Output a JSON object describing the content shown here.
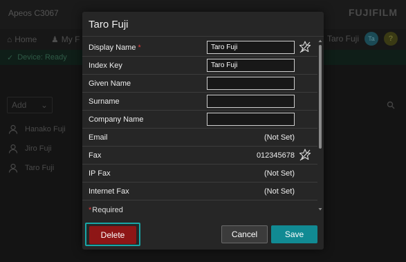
{
  "background": {
    "device_title": "Apeos C3067",
    "brand": "FUJIFILM",
    "nav": {
      "home": "Home",
      "my": "My F"
    },
    "user": {
      "name": "Taro Fuji",
      "initials": "Ta",
      "help": "?"
    },
    "status": "Device: Ready",
    "add_label": "Add",
    "list": [
      "Hanako Fuji",
      "Jiro Fuji",
      "Taro Fuji"
    ]
  },
  "dialog": {
    "title": "Taro Fuji",
    "fields": [
      {
        "label": "Display Name",
        "required": true,
        "value": "Taro Fuji",
        "type": "input"
      },
      {
        "label": "Index Key",
        "required": false,
        "value": "Taro Fuji",
        "type": "input"
      },
      {
        "label": "Given Name",
        "required": false,
        "value": "",
        "type": "input"
      },
      {
        "label": "Surname",
        "required": false,
        "value": "",
        "type": "input"
      },
      {
        "label": "Company Name",
        "required": false,
        "value": "",
        "type": "input"
      },
      {
        "label": "Email",
        "required": false,
        "value": "(Not Set)",
        "type": "text"
      },
      {
        "label": "Fax",
        "required": false,
        "value": "012345678",
        "type": "text"
      },
      {
        "label": "IP Fax",
        "required": false,
        "value": "(Not Set)",
        "type": "text"
      },
      {
        "label": "Internet Fax",
        "required": false,
        "value": "(Not Set)",
        "type": "text"
      }
    ],
    "required_star": "*",
    "required_note": "Required",
    "buttons": {
      "delete": "Delete",
      "cancel": "Cancel",
      "save": "Save"
    }
  },
  "colors": {
    "delete": "#8e1616",
    "save": "#118a93",
    "focus_ring": "#18a7a7",
    "required": "#e23b3b"
  },
  "icons": {
    "favorite": "pin-star-icon"
  }
}
